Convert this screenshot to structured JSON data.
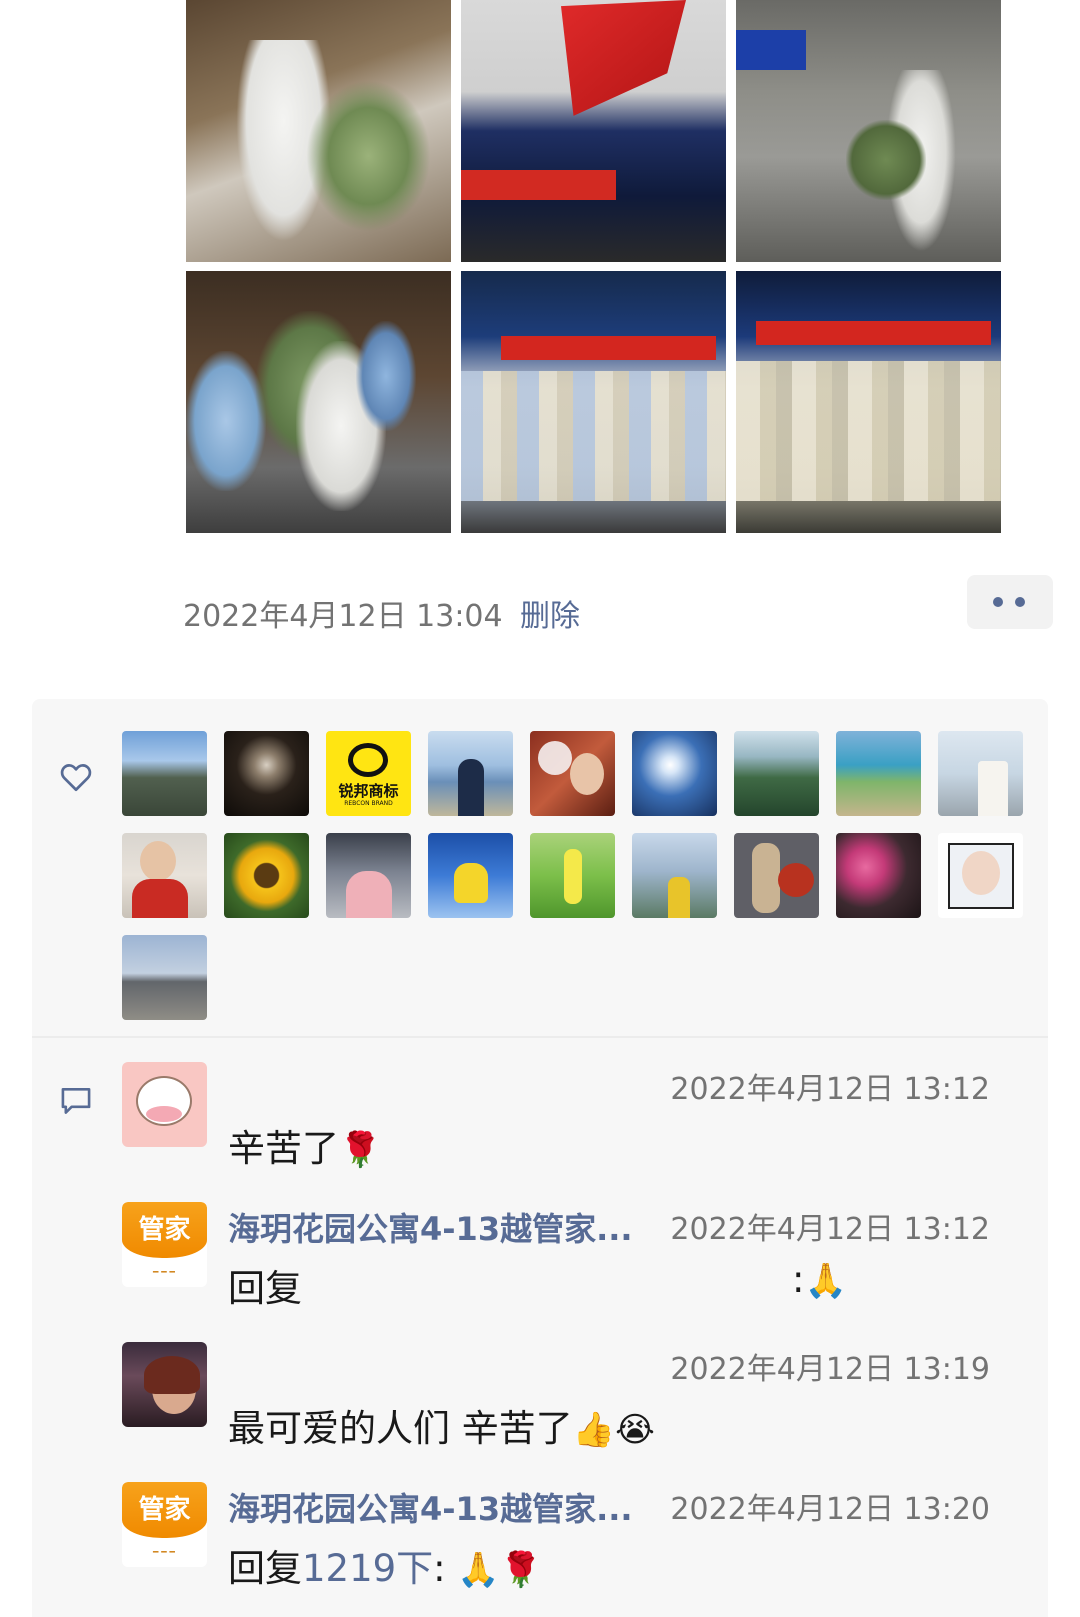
{
  "post": {
    "timestamp": "2022年4月12日 13:04",
    "delete_label": "删除",
    "photos": [
      {
        "name": "photo-volunteer-cart"
      },
      {
        "name": "photo-flag-tents"
      },
      {
        "name": "photo-street-carry"
      },
      {
        "name": "photo-lobby-delivery"
      },
      {
        "name": "photo-group-left"
      },
      {
        "name": "photo-group-right"
      }
    ]
  },
  "likes": {
    "icon": "heart-icon",
    "avatar_count": 19,
    "brand_avatar_text": "锐邦商标",
    "brand_avatar_subtext": "REBCON BRAND"
  },
  "comments": {
    "icon": "comment-icon",
    "items": [
      {
        "name": "",
        "time": "2022年4月12日 13:12",
        "text": "辛苦了",
        "emoji": "🌹",
        "avatar": "cartoon-cow-avatar"
      },
      {
        "name": "海玥花园公寓4-13越管家...",
        "time": "2022年4月12日 13:12",
        "reply_word": "回复",
        "reply_target": "",
        "text": ":",
        "emoji": "🙏",
        "avatar": "guanjia-logo-avatar",
        "avatar_text": "管家"
      },
      {
        "name": "",
        "time": "2022年4月12日 13:19",
        "text": "最可爱的人们 辛苦了",
        "emoji": "👍😭",
        "avatar": "woman-night-avatar"
      },
      {
        "name": "海玥花园公寓4-13越管家...",
        "time": "2022年4月12日 13:20",
        "reply_word": "回复",
        "reply_target": "1219下",
        "text": ":",
        "emoji": "🙏🌹",
        "avatar": "guanjia-logo-avatar",
        "avatar_text": "管家"
      }
    ]
  },
  "colors": {
    "link": "#576b95",
    "meta": "#737373",
    "panel": "#f7f7f7"
  }
}
